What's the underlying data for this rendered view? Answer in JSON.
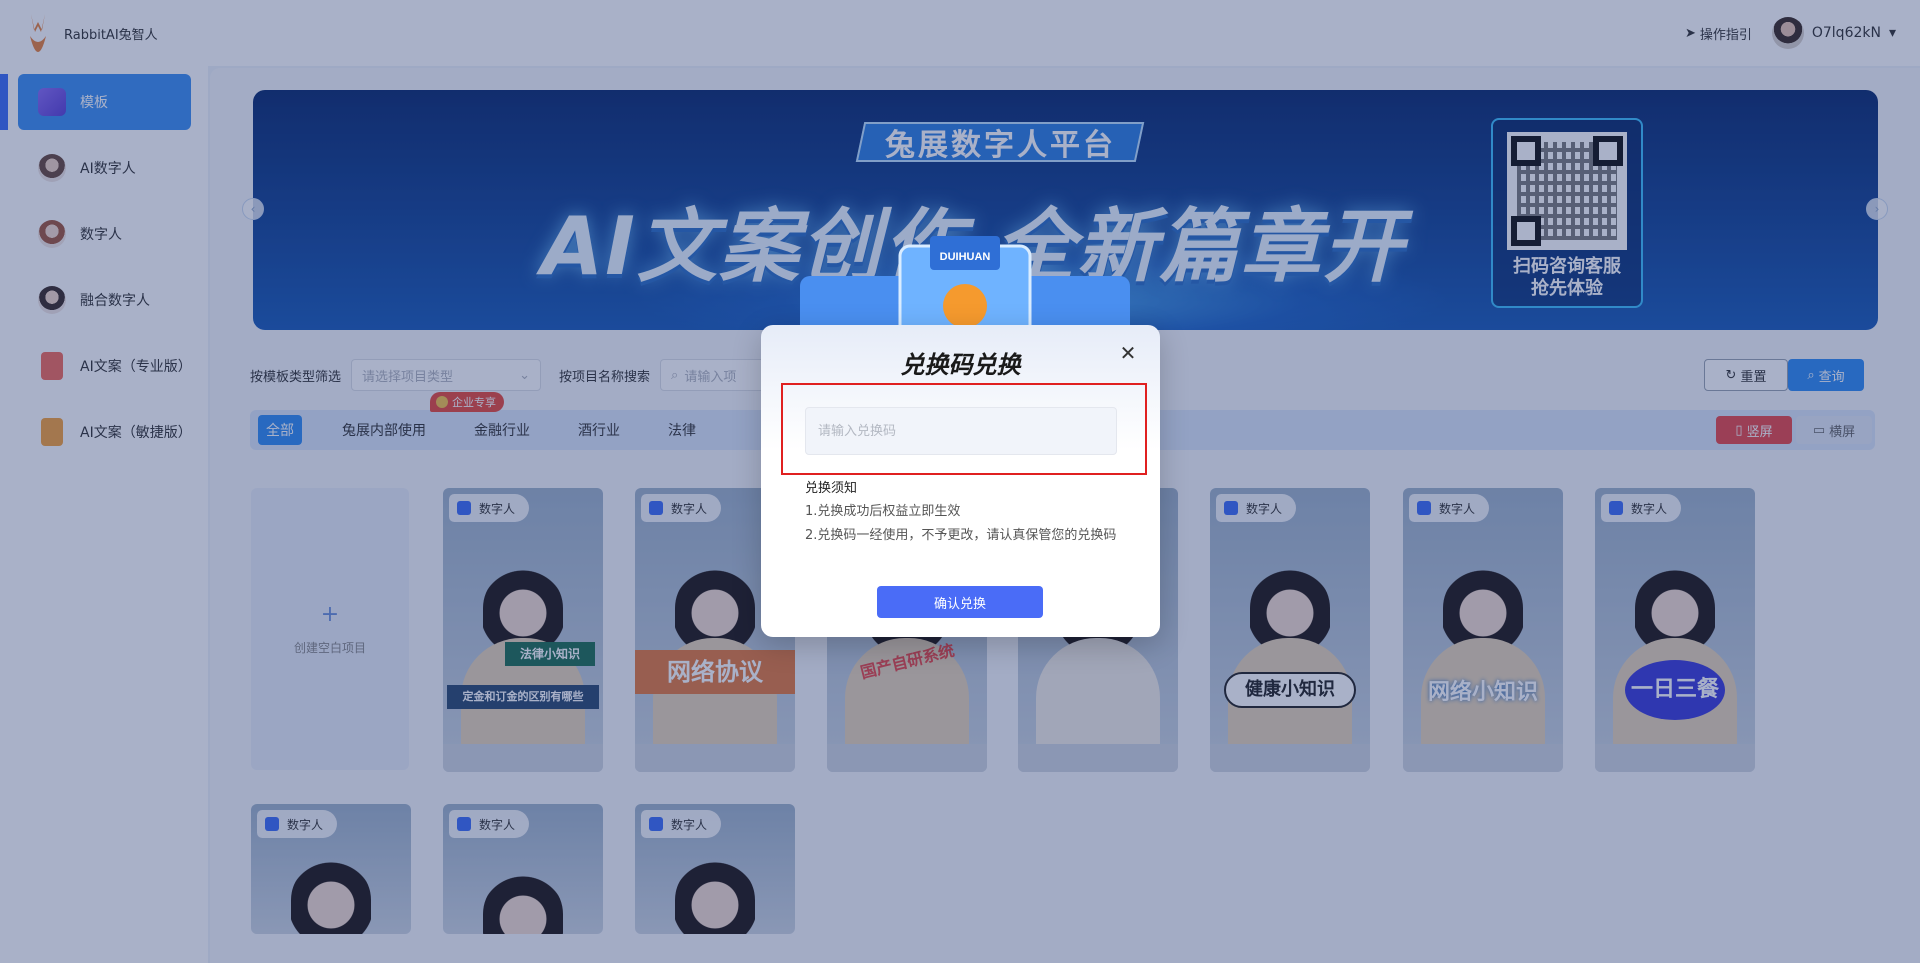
{
  "header": {
    "logo_text": "RabbitAI兔智人",
    "guide_label": "操作指引",
    "username": "O7lq62kN"
  },
  "sidebar": {
    "items": [
      {
        "label": "模板",
        "icon": "cube-icon"
      },
      {
        "label": "AI数字人",
        "icon": "avatar-icon"
      },
      {
        "label": "数字人",
        "icon": "avatar-icon"
      },
      {
        "label": "融合数字人",
        "icon": "avatar-icon"
      },
      {
        "label": "AI文案（专业版）",
        "icon": "document-icon"
      },
      {
        "label": "AI文案（敏捷版）",
        "icon": "document-icon"
      }
    ]
  },
  "banner": {
    "tag": "兔展数字人平台",
    "title": "AI文案创作 全新篇章开启",
    "qr_text_line1": "扫码咨询客服",
    "qr_text_line2": "抢先体验"
  },
  "filters": {
    "type_label": "按模板类型筛选",
    "type_placeholder": "请选择项目类型",
    "name_label": "按项目名称搜索",
    "name_placeholder": "请输入项",
    "reset_label": "重置",
    "query_label": "查询"
  },
  "categories": {
    "items": [
      "全部",
      "兔展内部使用",
      "金融行业",
      "酒行业",
      "法律"
    ],
    "enterprise_badge": "企业专享",
    "orient_portrait": "竖屏",
    "orient_landscape": "横屏"
  },
  "cards": {
    "blank_label": "创建空白项目",
    "tag": "数字人",
    "captions": [
      "法律小知识",
      "定金和订金的区别有哪些",
      "网络协议",
      "国产自研系统",
      "健康小知识",
      "网络小知识",
      "一日三餐"
    ]
  },
  "modal": {
    "title": "兑换码兑换",
    "input_placeholder": "请输入兑换码",
    "notice_title": "兑换须知",
    "notice_1": "1.兑换成功后权益立即生效",
    "notice_2": "2.兑换码一经使用，不予更改，请认真保管您的兑换码",
    "confirm_label": "确认兑换",
    "illustration_text": "DUIHUAN"
  },
  "colors": {
    "accent": "#2f8cf3",
    "confirm": "#4a6cf7",
    "highlight": "#e02020",
    "enterprise": "#e8493b"
  }
}
